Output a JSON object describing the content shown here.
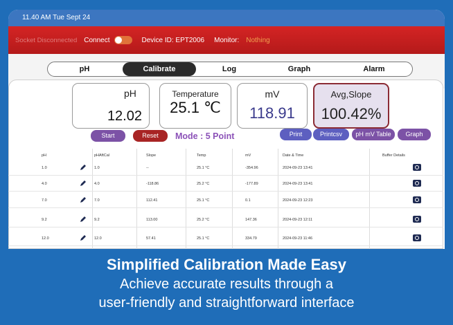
{
  "status_bar": {
    "time": "11.40 AM Tue Sept 24"
  },
  "connection": {
    "socket_status": "Socket Disconnected",
    "connect_label": "Connect",
    "device_id": "Device ID: EPT2006",
    "monitor_label": "Monitor:",
    "monitor_value": "Nothing"
  },
  "nav": {
    "tabs": [
      "pH",
      "Calibrate",
      "Log",
      "Graph",
      "Alarm"
    ],
    "active": "Calibrate"
  },
  "readings": {
    "ph": {
      "label": "pH",
      "value": "12.02"
    },
    "temperature": {
      "label": "Temperature",
      "value": "25.1 ℃"
    },
    "mv": {
      "label": "mV",
      "value": "118.91"
    },
    "slope": {
      "label": "Avg,Slope",
      "value": "100.42%"
    }
  },
  "controls": {
    "start": "Start",
    "reset": "Reset",
    "mode": "Mode : 5 Point",
    "print": "Print",
    "printcsv": "Printcsv",
    "ph_mv_table": "pH mV Table",
    "graph": "Graph"
  },
  "table": {
    "headers": [
      "pH",
      "pHAftCal",
      "Slope",
      "Temp",
      "mV",
      "Date & Time",
      "Buffer Details"
    ],
    "rows": [
      [
        "1.0",
        "1.0",
        "--",
        "25.1 °C",
        "-354.96",
        "2024-09-23  13:41"
      ],
      [
        "4.0",
        "4.0",
        "-118.86",
        "25.2 °C",
        "-177.89",
        "2024-09-23  13:41"
      ],
      [
        "7.0",
        "7.0",
        "112.41",
        "25.1 °C",
        "0.1",
        "2024-09-23  12:23"
      ],
      [
        "9.2",
        "9.2",
        "113.00",
        "25.2 °C",
        "147.36",
        "2024-09-23  12:11"
      ],
      [
        "12.0",
        "12.0",
        "57.41",
        "25.1 °C",
        "334.79",
        "2024-09-23  11:46"
      ]
    ]
  },
  "caption": {
    "headline": "Simplified Calibration Made Easy",
    "line1": "Achieve accurate results through a",
    "line2": "user-friendly and straightforward interface"
  },
  "icons": {
    "edit": "pencil-icon",
    "buffer": "camera-icon"
  },
  "colors": {
    "background": "#1f6db8",
    "header_red": "#c41f1f",
    "accent_purple": "#7c52a6",
    "accent_blue": "#5d5fc0"
  }
}
